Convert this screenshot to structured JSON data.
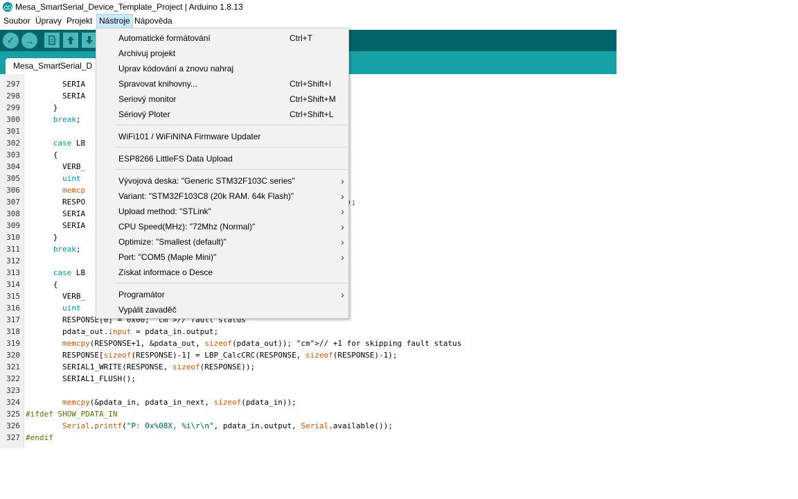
{
  "window": {
    "title": "Mesa_SmartSerial_Device_Template_Project | Arduino 1.8.13"
  },
  "menubar": {
    "items": [
      "Soubor",
      "Úpravy",
      "Projekt",
      "Nástroje",
      "Nápověda"
    ]
  },
  "toolbar": {
    "verify": "✓",
    "upload": "→"
  },
  "tabs": {
    "active": "Mesa_SmartSerial_D"
  },
  "tools_menu": {
    "groups": [
      [
        {
          "label": "Automatické formátování",
          "shortcut": "Ctrl+T"
        },
        {
          "label": "Archivuj projekt",
          "shortcut": ""
        },
        {
          "label": "Uprav kódování a znovu nahraj",
          "shortcut": ""
        },
        {
          "label": "Spravovat knihovny...",
          "shortcut": "Ctrl+Shift+I"
        },
        {
          "label": "Seriový monitor",
          "shortcut": "Ctrl+Shift+M"
        },
        {
          "label": "Sériový Ploter",
          "shortcut": "Ctrl+Shift+L"
        }
      ],
      [
        {
          "label": "WiFi101 / WiFiNINA Firmware Updater",
          "shortcut": ""
        }
      ],
      [
        {
          "label": "ESP8266 LittleFS Data Upload",
          "shortcut": ""
        }
      ],
      [
        {
          "label": "Vývojová deska: \"Generic STM32F103C series\"",
          "submenu": true
        },
        {
          "label": "Variant: \"STM32F103C8 (20k RAM. 64k Flash)\"",
          "submenu": true
        },
        {
          "label": "Upload method: \"STLink\"",
          "submenu": true
        },
        {
          "label": "CPU Speed(MHz): \"72Mhz (Normal)\"",
          "submenu": true
        },
        {
          "label": "Optimize: \"Smallest (default)\"",
          "submenu": true
        },
        {
          "label": "Port: \"COM5 (Maple Mini)\"",
          "submenu": true
        },
        {
          "label": "Získat informace o Desce",
          "submenu": false
        }
      ],
      [
        {
          "label": "Programátor",
          "submenu": true
        },
        {
          "label": "Vypálit zavaděč",
          "submenu": false
        }
      ]
    ]
  },
  "editor": {
    "lines": [
      {
        "n": "297",
        "code": "        SERIA"
      },
      {
        "n": "298",
        "code": "        SERIA"
      },
      {
        "n": "299",
        "code": "      }"
      },
      {
        "n": "300",
        "code": "      break;"
      },
      {
        "n": "301",
        "code": ""
      },
      {
        "n": "302",
        "code": "      case LB"
      },
      {
        "n": "303",
        "code": "      {"
      },
      {
        "n": "304",
        "code": "        VERB_                                         r\\n\");"
      },
      {
        "n": "305",
        "code": "        uint"
      },
      {
        "n": "306",
        "code": "        memcp"
      },
      {
        "n": "307",
        "code": "        RESPO                                          eof(RESPONSE)-1);"
      },
      {
        "n": "308",
        "code": "        SERIA"
      },
      {
        "n": "309",
        "code": "        SERIA"
      },
      {
        "n": "310",
        "code": "      }"
      },
      {
        "n": "311",
        "code": "      break;"
      },
      {
        "n": "312",
        "code": ""
      },
      {
        "n": "313",
        "code": "      case LB"
      },
      {
        "n": "314",
        "code": "      {"
      },
      {
        "n": "315",
        "code": "        VERB_                                         \\r\\n\");"
      },
      {
        "n": "316",
        "code": "        uint"
      },
      {
        "n": "317",
        "code": "        RESPONSE[0] = 0x00; // fault status"
      },
      {
        "n": "318",
        "code": "        pdata_out.input = pdata_in.output;"
      },
      {
        "n": "319",
        "code": "        memcpy(RESPONSE+1, &pdata_out, sizeof(pdata_out)); // +1 for skipping fault status"
      },
      {
        "n": "320",
        "code": "        RESPONSE[sizeof(RESPONSE)-1] = LBP_CalcCRC(RESPONSE, sizeof(RESPONSE)-1);"
      },
      {
        "n": "321",
        "code": "        SERIAL1_WRITE(RESPONSE, sizeof(RESPONSE));"
      },
      {
        "n": "322",
        "code": "        SERIAL1_FLUSH();"
      },
      {
        "n": "323",
        "code": ""
      },
      {
        "n": "324",
        "code": "        memcpy(&pdata_in, pdata_in_next, sizeof(pdata_in));"
      },
      {
        "n": "325",
        "code": "#ifdef SHOW_PDATA_IN"
      },
      {
        "n": "326",
        "code": "        Serial.printf(\"P: 0x%08X, %i\\r\\n\", pdata_in.output, Serial.available());"
      },
      {
        "n": "327",
        "code": "#endif"
      }
    ]
  }
}
